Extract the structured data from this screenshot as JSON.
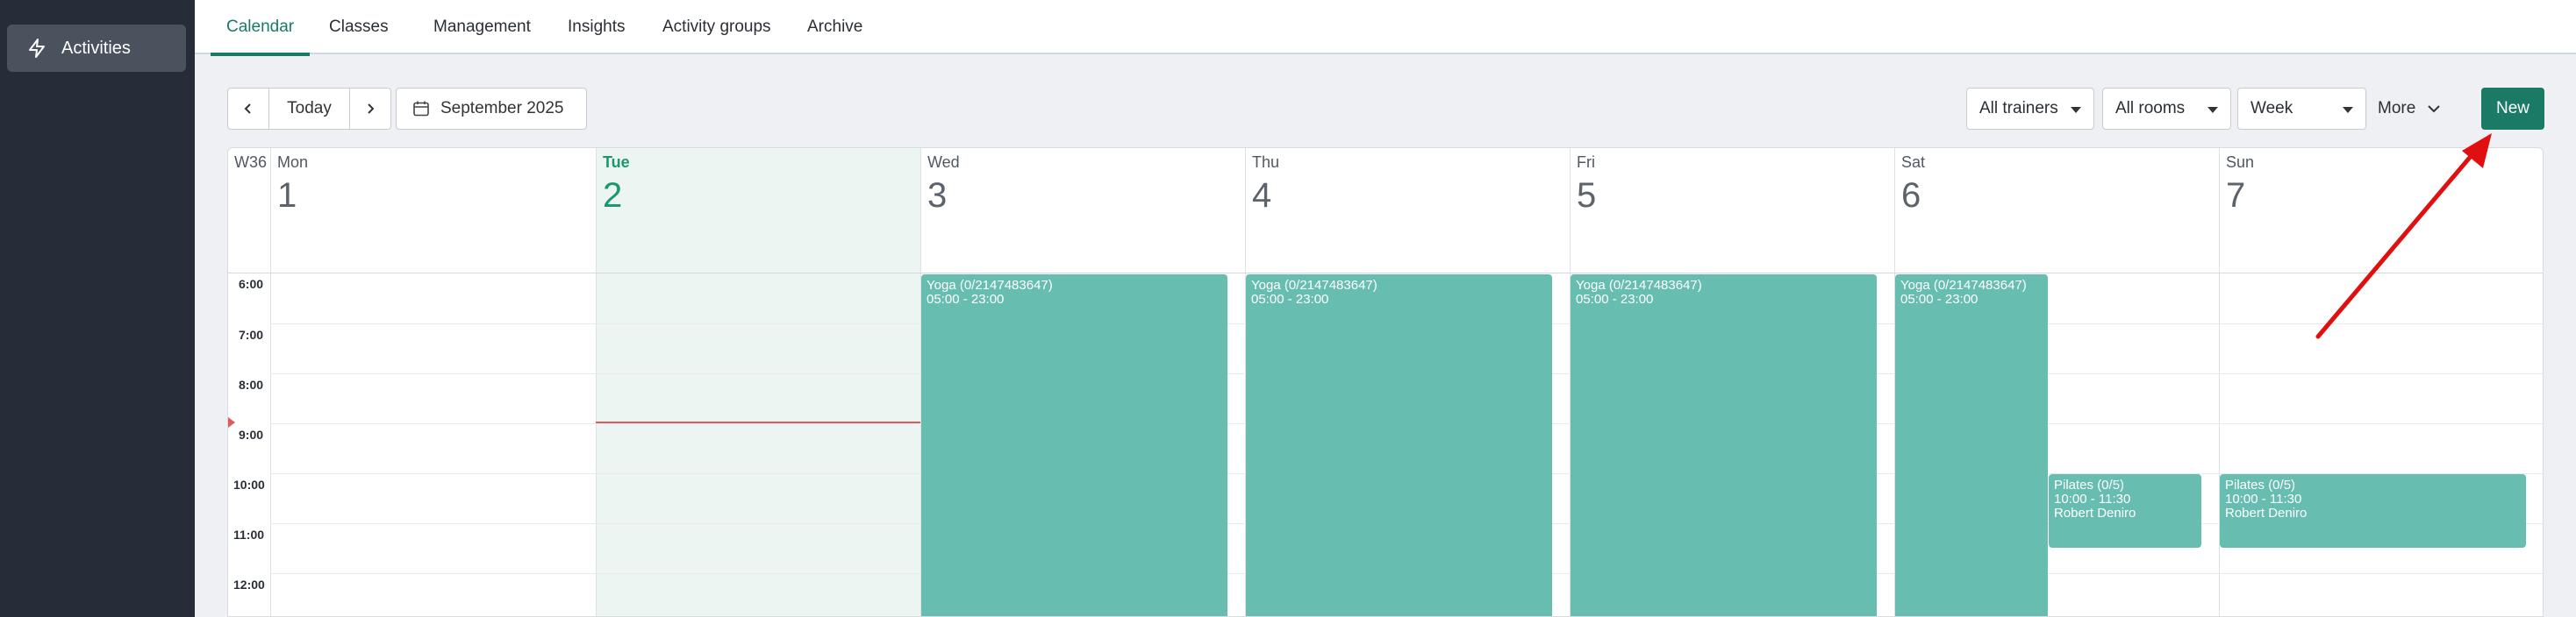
{
  "sidebar": {
    "items": [
      {
        "label": "Activities",
        "icon": "lightning-icon"
      }
    ]
  },
  "tabs": [
    {
      "label": "Calendar",
      "active": true
    },
    {
      "label": "Classes"
    },
    {
      "label": "Management"
    },
    {
      "label": "Insights"
    },
    {
      "label": "Activity groups"
    },
    {
      "label": "Archive"
    }
  ],
  "toolbar": {
    "today_label": "Today",
    "date_label": "September 2025",
    "trainer_filter": "All trainers",
    "room_filter": "All rooms",
    "view_filter": "Week",
    "more_label": "More",
    "new_label": "New"
  },
  "calendar": {
    "week_label": "W36",
    "days": [
      {
        "name": "Mon",
        "num": "1"
      },
      {
        "name": "Tue",
        "num": "2",
        "today": true
      },
      {
        "name": "Wed",
        "num": "3"
      },
      {
        "name": "Thu",
        "num": "4"
      },
      {
        "name": "Fri",
        "num": "5"
      },
      {
        "name": "Sat",
        "num": "6"
      },
      {
        "name": "Sun",
        "num": "7"
      }
    ],
    "times": [
      "6:00",
      "7:00",
      "8:00",
      "9:00",
      "10:00",
      "11:00",
      "12:00"
    ],
    "events": [
      {
        "title": "Yoga (0/2147483647)",
        "time": "05:00 - 23:00",
        "trainer": ""
      },
      {
        "title": "Yoga (0/2147483647)",
        "time": "05:00 - 23:00",
        "trainer": ""
      },
      {
        "title": "Yoga (0/2147483647)",
        "time": "05:00 - 23:00",
        "trainer": ""
      },
      {
        "title": "Yoga (0/2147483647)",
        "time": "05:00 - 23:00",
        "trainer": ""
      },
      {
        "title": "Pilates (0/5)",
        "time": "10:00 - 11:30",
        "trainer": "Robert Deniro"
      },
      {
        "title": "Pilates (0/5)",
        "time": "10:00 - 11:30",
        "trainer": "Robert Deniro"
      }
    ]
  },
  "colors": {
    "accent": "#1a7a66",
    "event": "#67bdb0",
    "sidebar": "#262d38",
    "now_line": "#e05a5a",
    "annotation_arrow": "#e01010"
  }
}
